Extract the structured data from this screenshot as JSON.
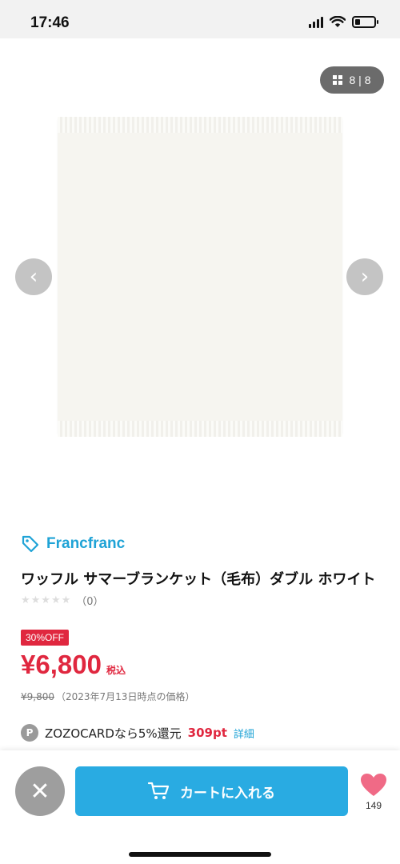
{
  "status_bar": {
    "time": "17:46"
  },
  "gallery": {
    "counter_current": "8",
    "counter_separator": "|",
    "counter_total": "8",
    "prev_arrow": "‹",
    "next_arrow": "›"
  },
  "product": {
    "brand": "Francfranc",
    "title": "ワッフル サマーブランケット（毛布）ダブル ホワイト",
    "stars": "★★★★★",
    "rating_stars_filled": 0,
    "review_count": "（0）",
    "discount_badge": "30%OFF",
    "price": "¥6,800",
    "tax_label": "税込",
    "old_price": "¥9,800",
    "old_price_note": "（2023年7月13日時点の価格）"
  },
  "points": {
    "icon_letter": "P",
    "text": "ZOZOCARDなら5%還元",
    "amount": "309pt",
    "link": "詳細"
  },
  "bottom_bar": {
    "close_symbol": "✕",
    "cart_label": "カートに入れる",
    "favorite_count": "149"
  },
  "colors": {
    "brand_blue": "#1fa3d6",
    "cart_blue": "#29abe2",
    "sale_red": "#e0273f",
    "heart_pink": "#f06a86"
  },
  "icons": [
    "wifi-icon",
    "signal-icon",
    "battery-icon",
    "grid-icon",
    "tag-icon",
    "cart-icon",
    "heart-icon",
    "close-icon"
  ]
}
